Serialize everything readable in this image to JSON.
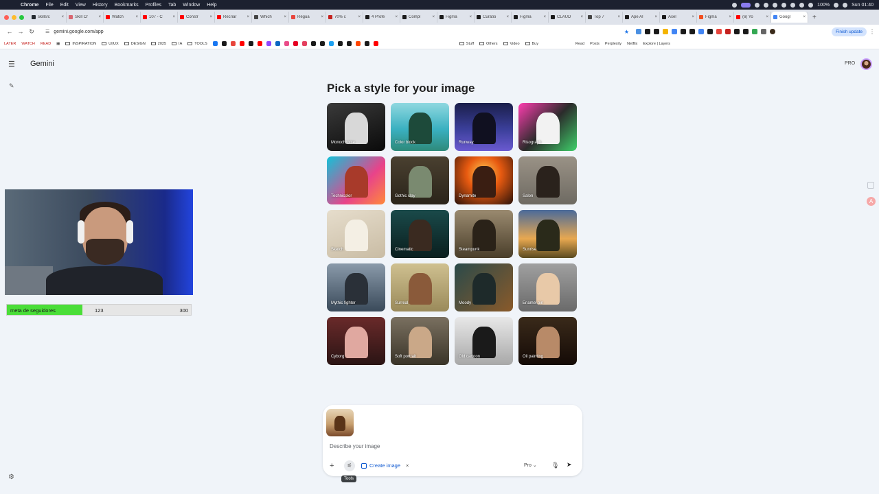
{
  "menubar": {
    "app": "Chrome",
    "items": [
      "File",
      "Edit",
      "View",
      "History",
      "Bookmarks",
      "Profiles",
      "Tab",
      "Window",
      "Help"
    ],
    "battery": "100%",
    "clock": "Sun 01:40"
  },
  "tabs": [
    {
      "label": "skills/c",
      "color": "#24292f"
    },
    {
      "label": "Skill Cr",
      "color": "#d96570"
    },
    {
      "label": "Watch",
      "color": "#ff0000"
    },
    {
      "label": "107 - C",
      "color": "#ff0000"
    },
    {
      "label": "Constr",
      "color": "#ff0000"
    },
    {
      "label": "Recriar",
      "color": "#ff0000"
    },
    {
      "label": "Which",
      "color": "#444444"
    },
    {
      "label": "Régua",
      "color": "#e8453c"
    },
    {
      "label": "70% c",
      "color": "#c5221f"
    },
    {
      "label": "4 Profe",
      "color": "#1a1a1a"
    },
    {
      "label": "Compl",
      "color": "#1a1a1a"
    },
    {
      "label": "Figma",
      "color": "#1a1a1a"
    },
    {
      "label": "Curatio",
      "color": "#1a1a1a"
    },
    {
      "label": "Figma",
      "color": "#1a1a1a"
    },
    {
      "label": "CLAUD",
      "color": "#1a1a1a"
    },
    {
      "label": "Top 7",
      "color": "#444444"
    },
    {
      "label": "Ape AI",
      "color": "#1a1a1a"
    },
    {
      "label": "Axel",
      "color": "#1a1a1a"
    },
    {
      "label": "Figma",
      "color": "#f24e1e"
    },
    {
      "label": "(6) Yo",
      "color": "#ff0000"
    },
    {
      "label": "Googl",
      "color": "#4285f4",
      "active": true
    }
  ],
  "toolbar": {
    "url": "gemini.google.com/app",
    "finish_update": "Finish update"
  },
  "bookmarks": {
    "later": "LATER",
    "watch": "WATCH",
    "read": "READ",
    "folders": [
      "INSPIRATION",
      "UI|UX",
      "DESIGN",
      "2025",
      "IA",
      "TOOLS"
    ],
    "icon_colors": [
      "#1877f2",
      "#1a1a1a",
      "#e8453c",
      "#ff0000",
      "#1a1a1a",
      "#ff0000",
      "#9146ff",
      "#0a66c2",
      "#ea4c89",
      "#e60023",
      "#e4405f",
      "#1a1a1a",
      "#1a1a1a",
      "#1da1f2",
      "#1a1a1a",
      "#1a1a1a",
      "#ff4500",
      "#1a1a1a",
      "#ff0000"
    ],
    "right_items": [
      "Stuff",
      "Others",
      "Video",
      "Buy",
      "Read",
      "Posts",
      "Perplexity",
      "Netflix",
      "Explore | Layers"
    ]
  },
  "gemini": {
    "title": "Gemini",
    "pro": "PRO",
    "heading": "Pick a style for your image"
  },
  "styles": [
    {
      "label": "Monochrome",
      "bg": "linear-gradient(160deg,#3a3a3a,#0a0a0a)",
      "fig": "#d8d8d8"
    },
    {
      "label": "Color block",
      "bg": "linear-gradient(180deg,#8fd8e0 0%,#3ab0c0 55%,#2e8a7a 100%)",
      "fig": "#1d4a3a"
    },
    {
      "label": "Runway",
      "bg": "linear-gradient(180deg,#1a1e4a 0%,#3b3f9a 55%,#6a5ad0 100%)",
      "fig": "#101020"
    },
    {
      "label": "Risograph",
      "bg": "linear-gradient(135deg,#ff3db0 0%,#2b2b2b 50%,#3fd06a 100%)",
      "fig": "#f2f2f2"
    },
    {
      "label": "Technicolor",
      "bg": "linear-gradient(135deg,#12c2d8 0%,#e8438a 60%,#ff8a3a 100%)",
      "fig": "#a83a2a"
    },
    {
      "label": "Gothic clay",
      "bg": "linear-gradient(180deg,#4a4030 0%,#2a241a 100%)",
      "fig": "#7a8a70"
    },
    {
      "label": "Dynamite",
      "bg": "radial-gradient(circle at 50% 35%,#ffcc55 0%,#e85a10 40%,#2a120a 100%)",
      "fig": "#3a1e12"
    },
    {
      "label": "Salon",
      "bg": "linear-gradient(180deg,#9a9286 0%,#6e6a62 100%)",
      "fig": "#2a221c"
    },
    {
      "label": "Sketch",
      "bg": "linear-gradient(160deg,#e6ddcc 0%,#c9bca4 100%)",
      "fig": "#f4efe4"
    },
    {
      "label": "Cinematic",
      "bg": "linear-gradient(180deg,#1a4a4a 0%,#0a1e1e 100%)",
      "fig": "#3a2a20"
    },
    {
      "label": "Steampunk",
      "bg": "linear-gradient(180deg,#9a8a70 0%,#4a3e2a 100%)",
      "fig": "#2a2218"
    },
    {
      "label": "Sunrise",
      "bg": "linear-gradient(180deg,#4a6a9a 0%,#e8a850 60%,#5a4a20 100%)",
      "fig": "#2a2a1a"
    },
    {
      "label": "Mythic fighter",
      "bg": "linear-gradient(180deg,#8a9aaa 0%,#3a4a5a 100%)",
      "fig": "#2a3038"
    },
    {
      "label": "Surreal",
      "bg": "linear-gradient(180deg,#cfc090 0%,#9a8a5a 100%)",
      "fig": "#8a5a3a"
    },
    {
      "label": "Moody",
      "bg": "linear-gradient(135deg,#2a4a4a 0%,#8a5a2a 100%)",
      "fig": "#1e2a2a"
    },
    {
      "label": "Enamel pin",
      "bg": "linear-gradient(180deg,#a0a0a0 0%,#6a6a6a 100%)",
      "fig": "#e8c9a8"
    },
    {
      "label": "Cyborg",
      "bg": "linear-gradient(180deg,#6a2a2a 0%,#2a1414 100%)",
      "fig": "#e0a8a0"
    },
    {
      "label": "Soft portrait",
      "bg": "linear-gradient(180deg,#7a7060 0%,#3a3428 100%)",
      "fig": "#caa888"
    },
    {
      "label": "Old cartoon",
      "bg": "linear-gradient(180deg,#e8e8e8 0%,#a8a8a8 100%)",
      "fig": "#1a1a1a"
    },
    {
      "label": "Oil painting",
      "bg": "linear-gradient(180deg,#3a2a1a 0%,#140a06 100%)",
      "fig": "#b88a68"
    }
  ],
  "overlay": {
    "goal_label": "meta de seguidores",
    "current": "123",
    "target": "300",
    "progress": 0.41
  },
  "prompt": {
    "placeholder": "Describe your image",
    "create_image": "Create image",
    "model": "Pro",
    "tooltip": "Tools"
  },
  "colors": {
    "background": "#f0f4f9",
    "accent": "#0b57d0",
    "progress_fill": "#4ade38"
  }
}
